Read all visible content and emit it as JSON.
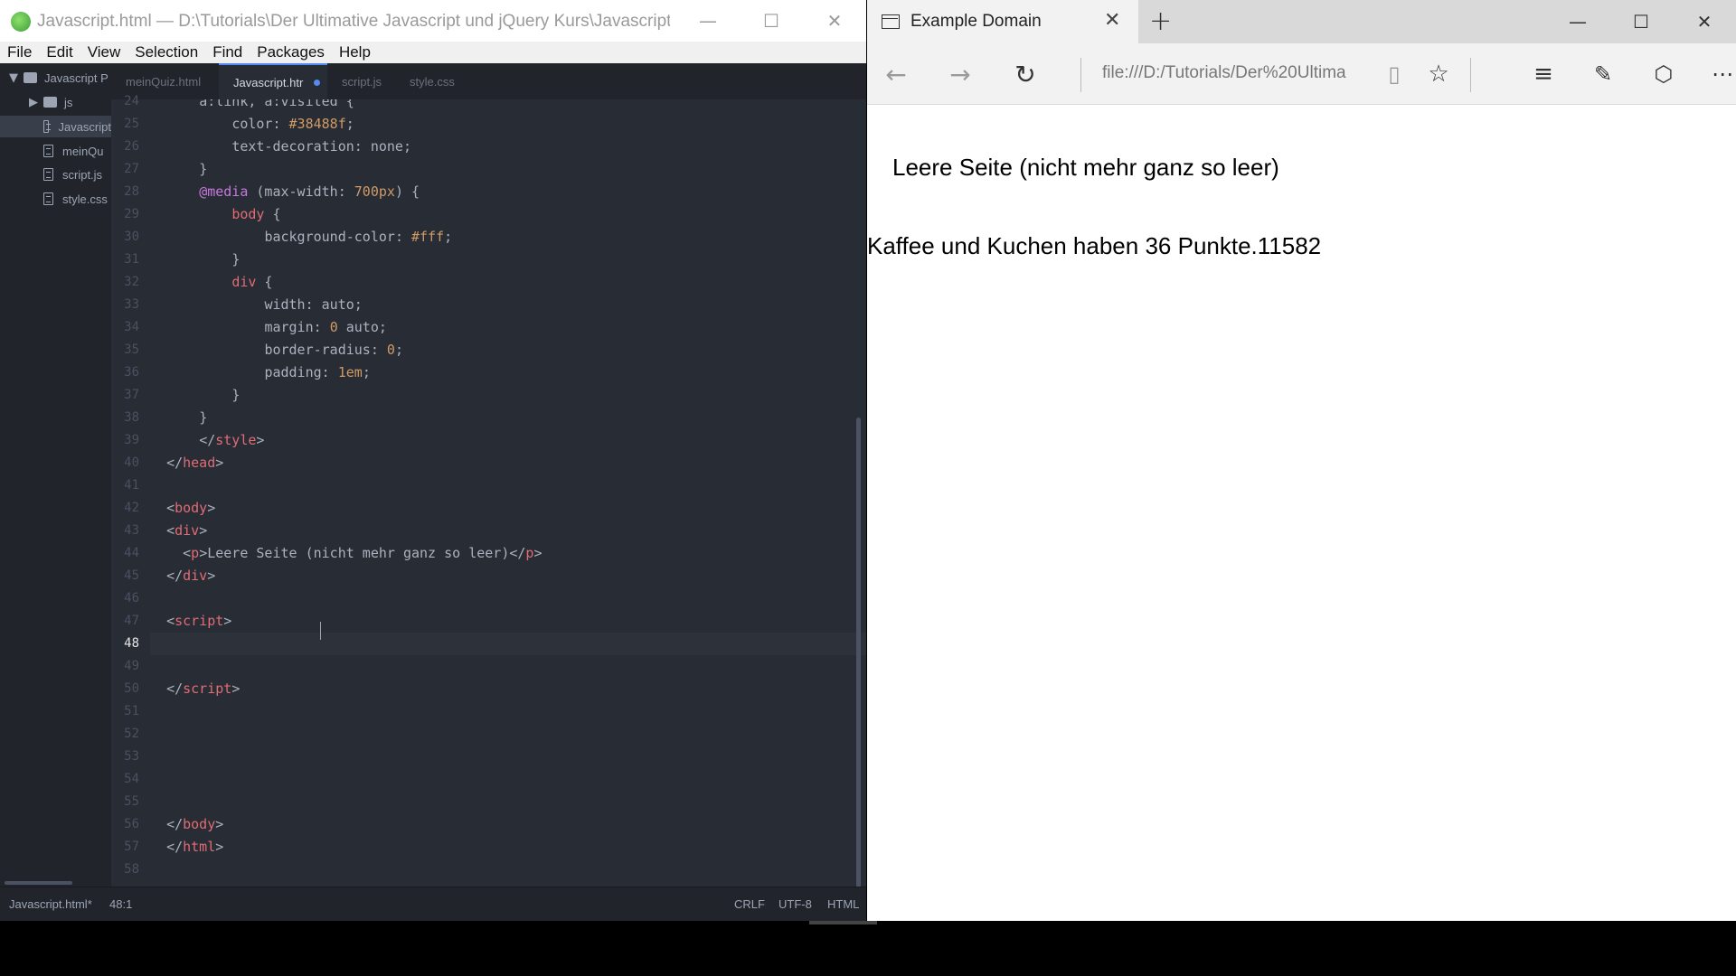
{
  "atom": {
    "title": "Javascript.html — D:\\Tutorials\\Der Ultimative Javascript und jQuery Kurs\\Javascript Proj...",
    "menu": [
      "File",
      "Edit",
      "View",
      "Selection",
      "Find",
      "Packages",
      "Help"
    ],
    "tree": {
      "root": "Javascript P",
      "folder": "js",
      "files": [
        "Javascript",
        "meinQu",
        "script.js",
        "style.css"
      ]
    },
    "tabs": [
      "meinQuiz.html",
      "Javascript.htr",
      "script.js",
      "style.css"
    ],
    "line_numbers": [
      "24",
      "25",
      "26",
      "27",
      "28",
      "29",
      "30",
      "31",
      "32",
      "33",
      "34",
      "35",
      "36",
      "37",
      "38",
      "39",
      "40",
      "41",
      "42",
      "43",
      "44",
      "45",
      "46",
      "47",
      "48",
      "49",
      "50",
      "51",
      "52",
      "53",
      "54",
      "55",
      "56",
      "57",
      "58"
    ],
    "cursor_line": "48",
    "status": {
      "file": "Javascript.html*",
      "position": "48:1",
      "line_ending": "CRLF",
      "encoding": "UTF-8",
      "grammar": "HTML"
    }
  },
  "edge": {
    "tab_title": "Example Domain",
    "address": "file:///D:/Tutorials/Der%20Ultima",
    "content": {
      "p1": "Leere Seite (nicht mehr ganz so leer)",
      "p2": "Kaffee und Kuchen haben 36 Punkte.11582"
    }
  },
  "colors": {
    "editor_bg": "#282c34",
    "panel_bg": "#21252b",
    "accent": "#568af2",
    "tag": "#e06c75",
    "number": "#d19a66",
    "keyword": "#c678dd"
  }
}
